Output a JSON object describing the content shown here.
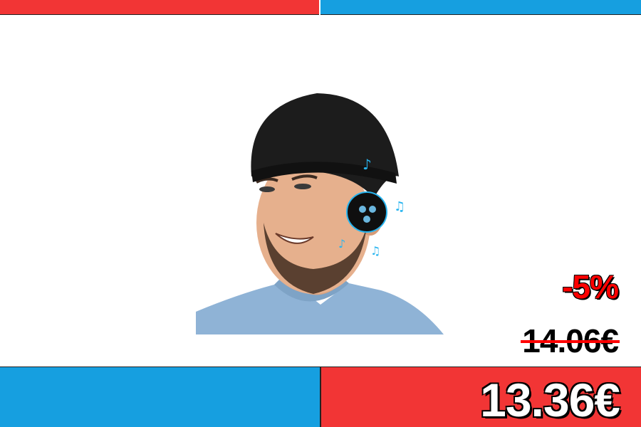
{
  "colors": {
    "accent_red": "#f23535",
    "accent_blue": "#169fe0"
  },
  "product": {
    "image_subject": "bluetooth-beanie-photo"
  },
  "pricing": {
    "discount": "-5%",
    "old_price": "14.06€",
    "current_price": "13.36€"
  }
}
